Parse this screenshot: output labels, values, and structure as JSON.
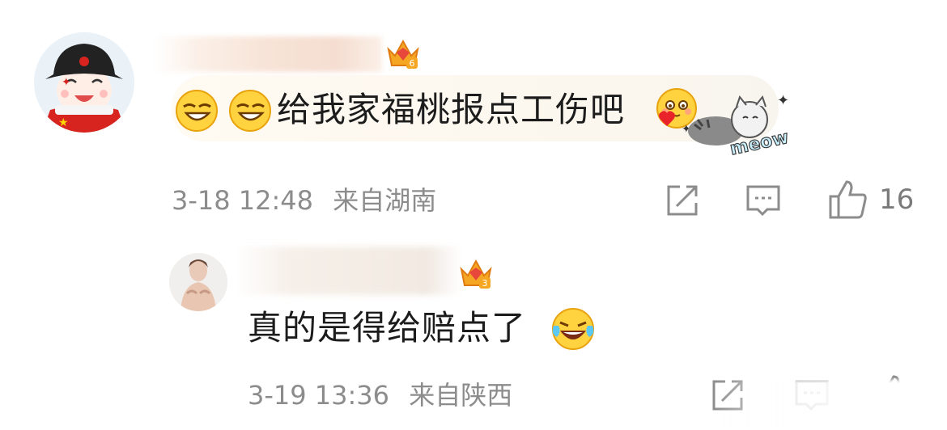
{
  "comments": [
    {
      "text": "给我家福桃报点工伤吧",
      "time": "3-18 12:48",
      "location": "来自湖南",
      "like_count": "16",
      "crown_level": "6",
      "emojis": [
        "smirk-emoji",
        "smirk-emoji",
        "heart-blush-emoji"
      ],
      "sticker": "meow-cat-sticker",
      "sticker_text": "meow"
    },
    {
      "text": "真的是得给赔点了",
      "time": "3-19 13:36",
      "location": "来自陕西",
      "crown_level": "3",
      "emojis": [
        "laugh-tears-emoji"
      ]
    }
  ],
  "colors": {
    "meta_text": "#8c8c8c",
    "body_text": "#1c1c1c",
    "crown_orange": "#f5a623",
    "crown_red": "#e8473b",
    "bubble_bg": "#fcf7ee"
  },
  "icons": [
    "share-icon",
    "comment-icon",
    "like-icon",
    "crown-icon"
  ]
}
